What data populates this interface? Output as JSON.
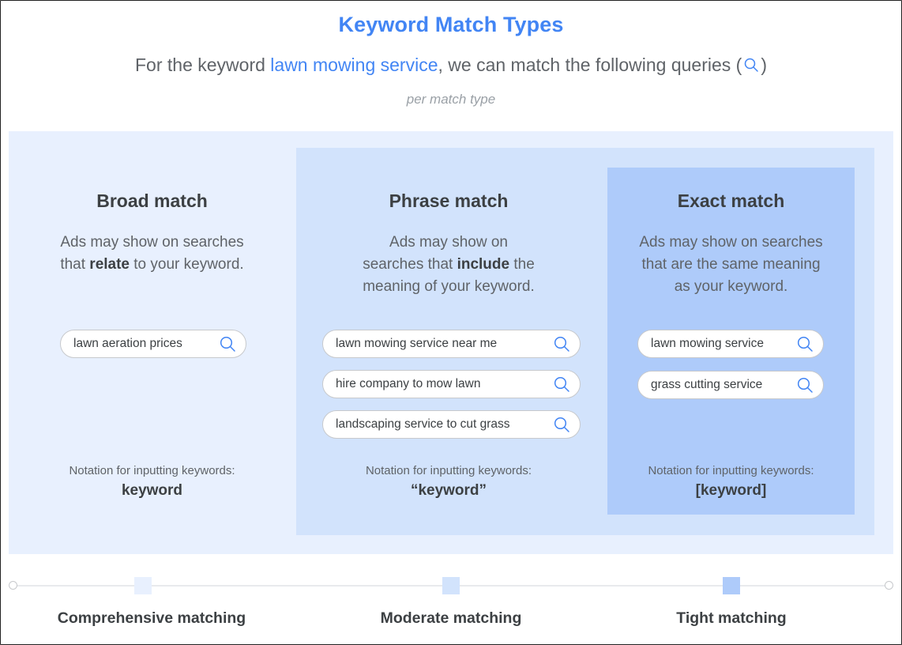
{
  "header": {
    "title": "Keyword Match Types",
    "subtitle_prefix": "For the keyword ",
    "subtitle_keyword": "lawn mowing service",
    "subtitle_suffix": ", we can match the following queries (",
    "subtitle_close": ")",
    "subtitle_icon": "search-icon",
    "per_match_type": "per match type"
  },
  "colors": {
    "accent": "#4285f4",
    "broad_bg": "#e8f0fe",
    "phrase_bg": "#d2e3fc",
    "exact_bg": "#aecbfa"
  },
  "columns": [
    {
      "title": "Broad match",
      "desc_lines": [
        {
          "pre": "Ads may show on searches",
          "bold": "",
          "post": ""
        },
        {
          "pre": "that ",
          "bold": "relate",
          "post": " to your keyword."
        }
      ],
      "queries": [
        "lawn aeration prices"
      ],
      "notation_label": "Notation for inputting keywords:",
      "notation_value": "keyword"
    },
    {
      "title": "Phrase match",
      "desc_lines": [
        {
          "pre": "Ads may show on",
          "bold": "",
          "post": ""
        },
        {
          "pre": "searches that ",
          "bold": "include",
          "post": " the"
        },
        {
          "pre": "meaning of your keyword.",
          "bold": "",
          "post": ""
        }
      ],
      "queries": [
        "lawn mowing service near me",
        "hire company to mow lawn",
        "landscaping service to cut grass"
      ],
      "notation_label": "Notation for inputting keywords:",
      "notation_value": "“keyword”"
    },
    {
      "title": "Exact match",
      "desc_lines": [
        {
          "pre": "Ads may show on searches",
          "bold": "",
          "post": ""
        },
        {
          "pre": "that are the same meaning",
          "bold": "",
          "post": ""
        },
        {
          "pre": "as your keyword.",
          "bold": "",
          "post": ""
        }
      ],
      "queries": [
        "lawn mowing service",
        "grass cutting service"
      ],
      "notation_label": "Notation for inputting keywords:",
      "notation_value": "[keyword]"
    }
  ],
  "scale": {
    "labels": [
      "Comprehensive matching",
      "Moderate matching",
      "Tight matching"
    ]
  }
}
